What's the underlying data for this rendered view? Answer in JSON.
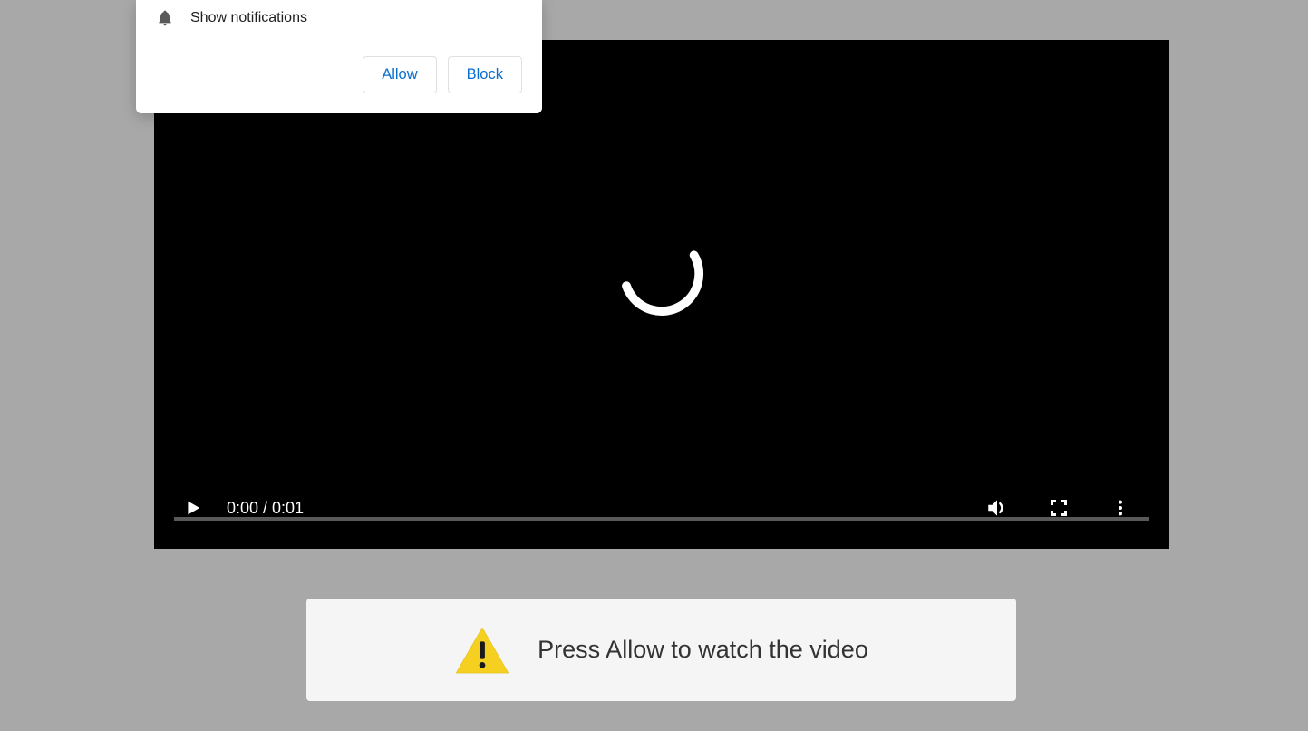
{
  "notification": {
    "text": "Show notifications",
    "allow_label": "Allow",
    "block_label": "Block"
  },
  "video": {
    "current_time": "0:00",
    "duration": "0:01",
    "time_display": "0:00 / 0:01"
  },
  "banner": {
    "text": "Press Allow to watch the video"
  }
}
